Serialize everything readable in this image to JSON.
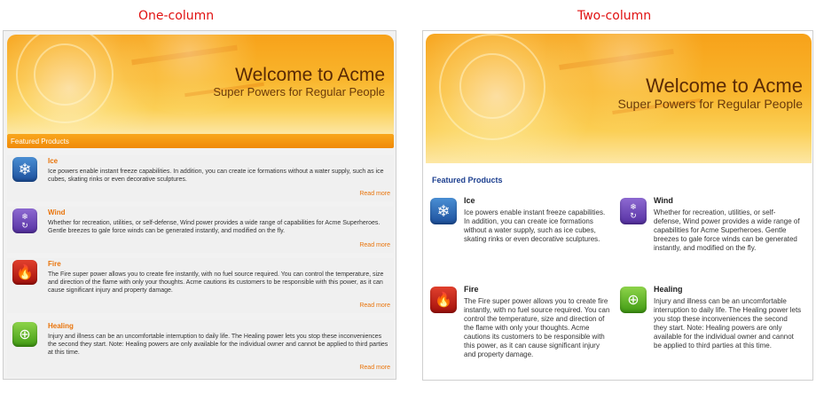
{
  "captions": {
    "one_column": "One-column",
    "two_column": "Two-column"
  },
  "banner": {
    "title": "Welcome to Acme",
    "subtitle": "Super Powers for Regular People"
  },
  "one_column": {
    "featured_label": "Featured Products",
    "read_more": "Read more"
  },
  "two_column": {
    "featured_label": "Featured Products"
  },
  "products": [
    {
      "name": "Ice",
      "icon": "snowflake-icon",
      "glyph": "❄",
      "color": "#2a66b8",
      "desc_one": "Ice powers enable instant freeze capabilities. In addition, you can create ice formations without a water supply, such as ice cubes, skating rinks or even decorative sculptures.",
      "desc_two": "Ice powers enable instant freeze capabilities. In addition, you can create ice formations without a water supply, such as ice cubes, skating rinks or even decorative sculptures."
    },
    {
      "name": "Wind",
      "icon": "wind-icon",
      "glyph": "❄",
      "glyph2": "↻",
      "color": "#6a43b8",
      "desc_one": "Whether for recreation, utilities, or self-defense, Wind power provides a wide range of capabilities for Acme Superheroes. Gentle breezes to gale force winds can be generated instantly, and modified on the fly.",
      "desc_two": "Whether for recreation, utilities, or self-defense, Wind power provides a wide range of capabilities for Acme Superheroes. Gentle breezes to gale force winds can be generated instantly, and modified on the fly."
    },
    {
      "name": "Fire",
      "icon": "flame-icon",
      "glyph": "🔥",
      "color": "#c52418",
      "desc_one": "The Fire super power allows you to create fire instantly, with no fuel source required. You can control the temperature, size and direction of the flame with only your thoughts. Acme cautions its customers to be responsible with this power, as it can cause significant injury and property damage.",
      "desc_two": "The Fire super power allows you to create fire instantly, with no fuel source required. You can control the temperature, size and direction of the flame with only your thoughts. Acme cautions its customers to be responsible with this power, as it can cause significant injury and property damage."
    },
    {
      "name": "Healing",
      "icon": "healing-icon",
      "glyph": "⊕",
      "color": "#5cb21f",
      "desc_one": "Injury and illness can be an uncomfortable interruption to daily life. The Healing power lets you stop these inconveniences the second they start. Note: Healing powers are only available for the individual owner and cannot be applied to third parties at this time.",
      "desc_two": "Injury and illness can be an uncomfortable interruption to daily life. The Healing power lets you stop these inconveniences the second they start. Note: Healing powers are only available for the individual owner and cannot be applied to third parties at this time."
    }
  ],
  "colors": {
    "caption": "#e01010",
    "accent_orange": "#e9740b",
    "featured_blue": "#1c3f8f"
  }
}
